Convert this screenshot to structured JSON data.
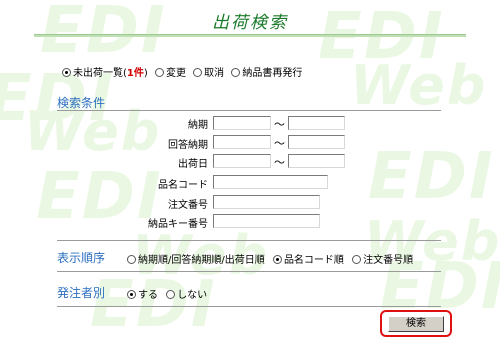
{
  "page_title": "出荷検索",
  "watermark": {
    "edi": "EDI",
    "web": "Web"
  },
  "status_options": {
    "unshipped_prefix": "未出荷一覧(",
    "unshipped_count": "1件",
    "unshipped_suffix": ")",
    "change": "変更",
    "cancel": "取消",
    "reissue": "納品書再発行",
    "selected": "unshipped"
  },
  "search_conditions": {
    "section_label": "検索条件",
    "tilde": "～",
    "delivery_date_label": "納期",
    "delivery_date_from": "",
    "delivery_date_to": "",
    "answer_delivery_label": "回答納期",
    "answer_delivery_from": "",
    "answer_delivery_to": "",
    "ship_date_label": "出荷日",
    "ship_date_from": "",
    "ship_date_to": "",
    "product_code_label": "品名コード",
    "product_code_value": "",
    "order_number_label": "注文番号",
    "order_number_value": "",
    "delivery_key_label": "納品キー番号",
    "delivery_key_value": ""
  },
  "sort_order": {
    "section_label": "表示順序",
    "option_date": "納期順/回答納期順/出荷日順",
    "option_product": "品名コード順",
    "option_order": "注文番号順",
    "selected": "product"
  },
  "orderer_filter": {
    "section_label": "発注者別",
    "option_yes": "する",
    "option_no": "しない",
    "selected": "yes"
  },
  "search_button_label": "検索",
  "colors": {
    "title": "#1b7a2a",
    "section_label": "#2d6fc0",
    "count": "#d00000",
    "highlight": "#e01010",
    "watermark": "#eaf8e3"
  }
}
